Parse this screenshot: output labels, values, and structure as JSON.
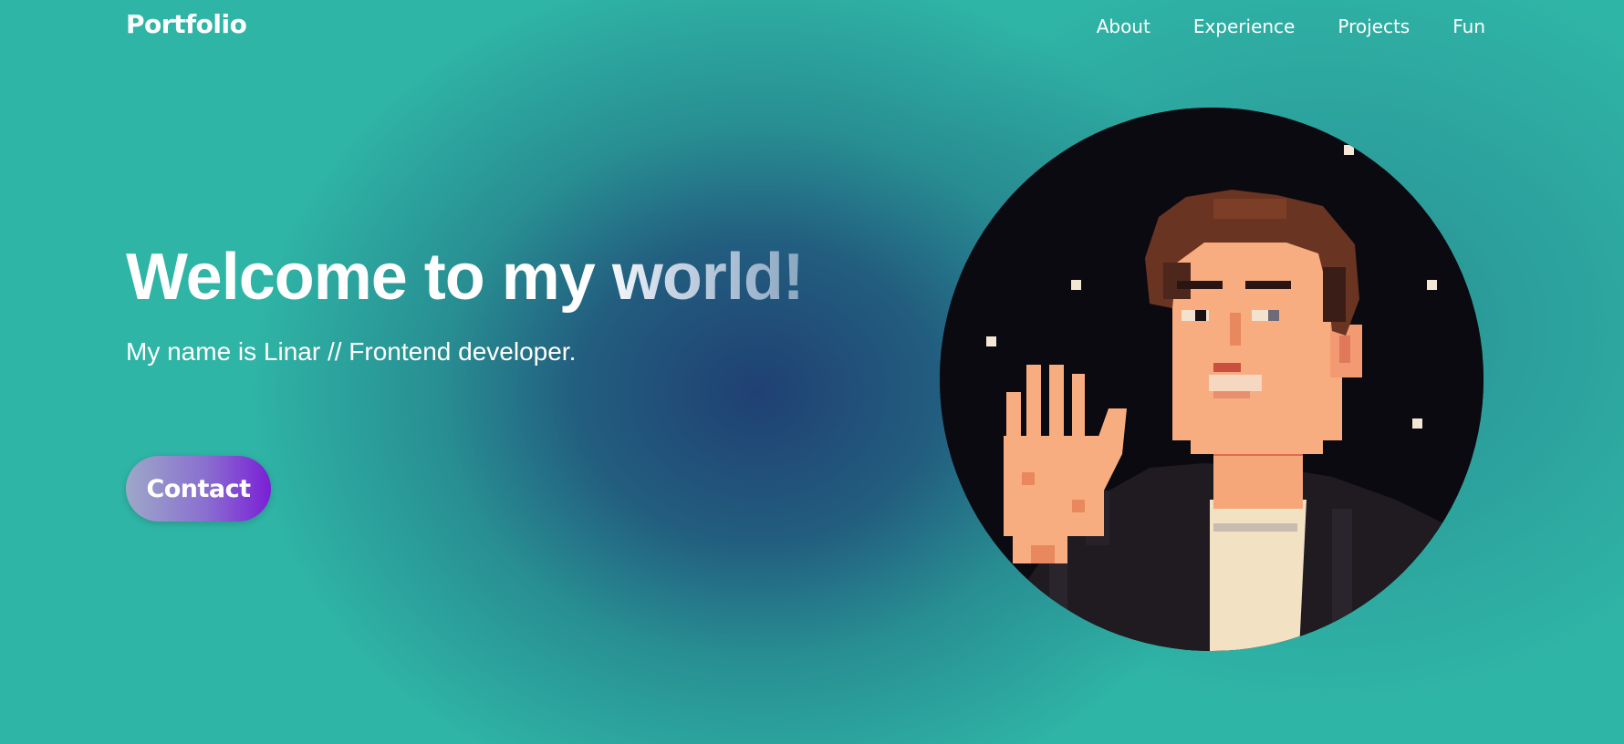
{
  "nav": {
    "logo": "Portfolio",
    "links": [
      "About",
      "Experience",
      "Projects",
      "Fun"
    ]
  },
  "hero": {
    "title": "Welcome to my world!",
    "subtitle": "My name is Linar // Frontend developer.",
    "contact_label": "Contact"
  },
  "avatar": {
    "description_icon": "pixel-art-portrait-waving"
  },
  "colors": {
    "background_teal": "#2fb5a6",
    "background_navy": "#1f3a70",
    "button_gradient_start": "#9da8c8",
    "button_gradient_end": "#7a1fd6",
    "avatar_bg": "#0b0a10"
  }
}
